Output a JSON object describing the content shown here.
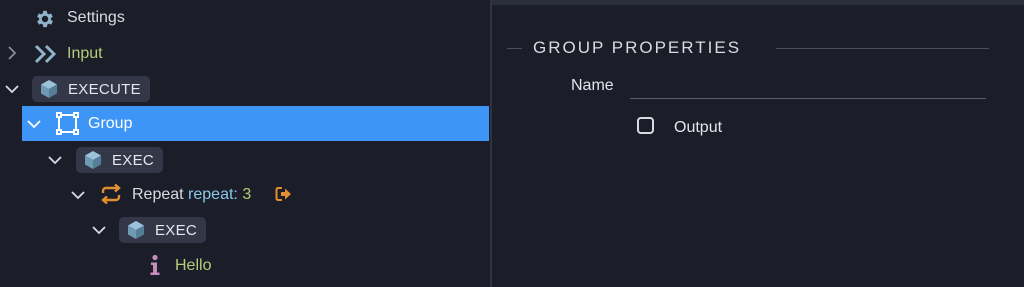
{
  "tree": {
    "settings": {
      "label": "Settings",
      "icon": "gear-icon"
    },
    "input": {
      "label": "Input",
      "icon": "double-chevron-icon"
    },
    "execute": {
      "label": "EXECUTE",
      "icon": "cube-icon"
    },
    "group": {
      "label": "Group",
      "icon": "group-selection-icon"
    },
    "exec1": {
      "label": "EXEC",
      "icon": "cube-icon"
    },
    "repeat": {
      "label": "Repeat",
      "param_name": "repeat",
      "param_sep": ":",
      "param_value": "3",
      "icon": "repeat-icon",
      "trail_icon": "exit-arrow-icon"
    },
    "exec2": {
      "label": "EXEC",
      "icon": "cube-icon"
    },
    "hello": {
      "label": "Hello",
      "icon": "info-icon"
    }
  },
  "properties": {
    "section_title": "GROUP PROPERTIES",
    "name_label": "Name",
    "name_value": "",
    "output_label": "Output",
    "output_checked": false
  },
  "colors": {
    "background": "#1b1d28",
    "selection": "#3d95f7",
    "pill": "#343747",
    "green_text": "#b5cc7a",
    "param_text": "#8cc8e8",
    "orange_icon": "#e0902e"
  }
}
